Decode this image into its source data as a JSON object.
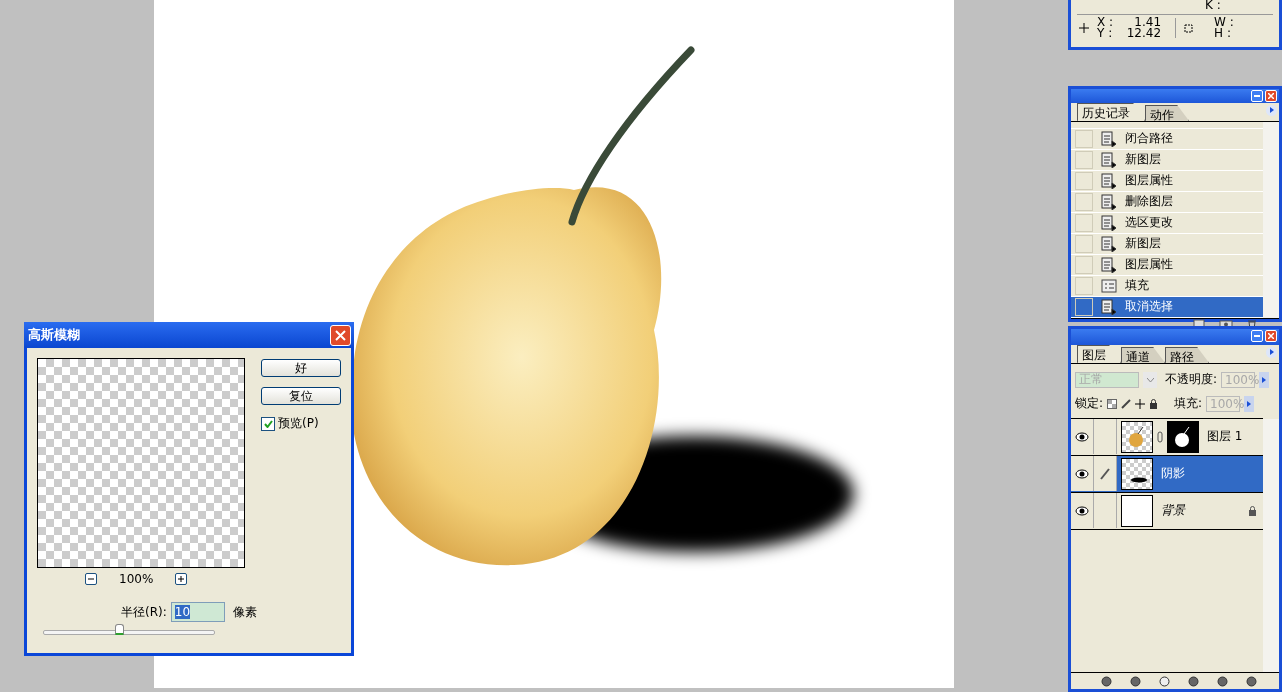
{
  "info": {
    "k_label": "K :",
    "x_label": "X :",
    "x_value": "1.41",
    "y_label": "Y :",
    "y_value": "12.42",
    "w_label": "W :",
    "h_label": "H :"
  },
  "history": {
    "tabs": [
      {
        "label": "历史记录",
        "selected": true
      },
      {
        "label": "动作",
        "selected": false
      }
    ],
    "items": [
      {
        "label": "闭合路径",
        "kind": "step",
        "selected": false
      },
      {
        "label": "新图层",
        "kind": "step",
        "selected": false
      },
      {
        "label": "图层属性",
        "kind": "step",
        "selected": false
      },
      {
        "label": "删除图层",
        "kind": "step",
        "selected": false
      },
      {
        "label": "选区更改",
        "kind": "step",
        "selected": false
      },
      {
        "label": "新图层",
        "kind": "step",
        "selected": false
      },
      {
        "label": "图层属性",
        "kind": "step",
        "selected": false
      },
      {
        "label": "填充",
        "kind": "fill",
        "selected": false
      },
      {
        "label": "取消选择",
        "kind": "step",
        "selected": true
      }
    ]
  },
  "layers": {
    "tabs": [
      {
        "label": "图层",
        "selected": true
      },
      {
        "label": "通道",
        "selected": false
      },
      {
        "label": "路径",
        "selected": false
      }
    ],
    "blend_mode": "正常",
    "opacity_label": "不透明度:",
    "opacity": "100%",
    "lock_label": "锁定:",
    "fill_label": "填充:",
    "fill": "100%",
    "items": [
      {
        "name": "图层 1",
        "kind": "masked",
        "selected": false,
        "visible": true,
        "locked": false
      },
      {
        "name": "阴影",
        "kind": "shadow",
        "selected": true,
        "visible": true,
        "locked": false
      },
      {
        "name": "背景",
        "kind": "background",
        "selected": false,
        "visible": true,
        "locked": true
      }
    ]
  },
  "dialog": {
    "title": "高斯模糊",
    "ok": "好",
    "reset": "复位",
    "preview": {
      "label": "预览(P)",
      "checked": true
    },
    "zoom": "100%",
    "radius_label": "半径(R):",
    "radius_value": "10",
    "unit": "像素",
    "radius_slider": {
      "level": 0.45
    }
  }
}
